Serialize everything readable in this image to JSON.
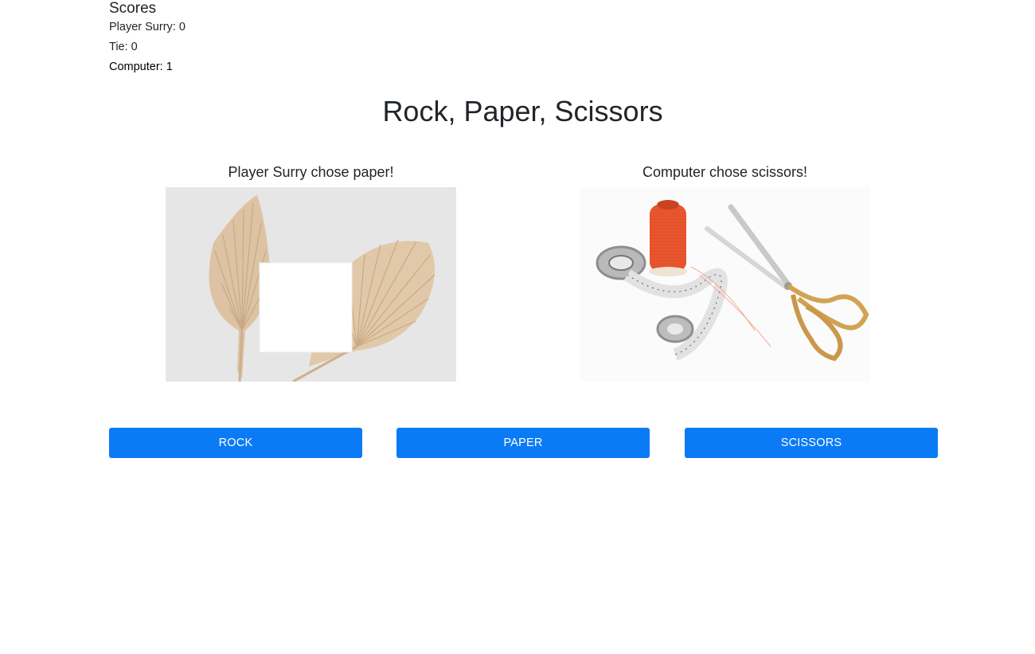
{
  "scores": {
    "heading": "Scores",
    "player": "Player Surry: 0",
    "tie": "Tie: 0",
    "computer": "Computer: 1"
  },
  "title": "Rock, Paper, Scissors",
  "player_choice": {
    "text": "Player Surry chose paper!",
    "image": "dried-palm-leaves-with-paper-photo"
  },
  "computer_choice": {
    "text": "Computer chose scissors!",
    "image": "scissors-thread-measuring-tape-photo"
  },
  "buttons": {
    "rock": "ROCK",
    "paper": "PAPER",
    "scissors": "SCISSORS"
  },
  "colors": {
    "button_bg": "#0b7bf5",
    "button_text": "#ffffff",
    "text": "#212529"
  }
}
